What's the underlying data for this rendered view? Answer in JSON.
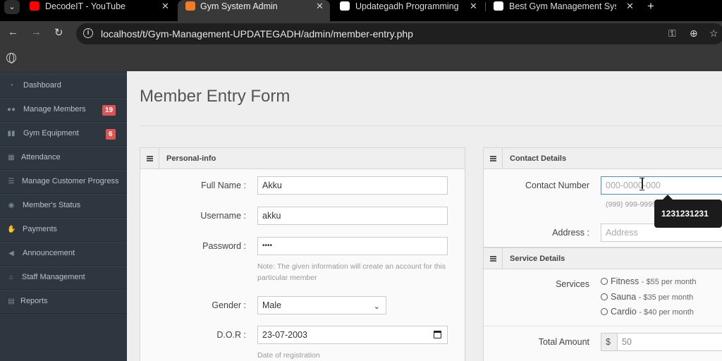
{
  "browser": {
    "tabs": [
      {
        "title": "DecodeIT - YouTube",
        "icon": "youtube-icon",
        "active": false
      },
      {
        "title": "Gym System Admin",
        "icon": "xampp-icon",
        "active": true
      },
      {
        "title": "Updategadh Programming - Up",
        "icon": "updategadh-icon",
        "active": false
      },
      {
        "title": "Best Gym Management System",
        "icon": "updategadh-icon",
        "active": false
      }
    ],
    "url": "localhost/t/Gym-Management-UPDATEGADH/admin/member-entry.php"
  },
  "sidebar": {
    "items": [
      {
        "label": "Dashboard",
        "icon": "dashboard-icon",
        "badge": null
      },
      {
        "label": "Manage Members",
        "icon": "users-icon",
        "badge": "19"
      },
      {
        "label": "Gym Equipment",
        "icon": "dumbbell-icon",
        "badge": "6"
      },
      {
        "label": "Attendance",
        "icon": "calendar-icon",
        "badge": null
      },
      {
        "label": "Manage Customer Progress",
        "icon": "list-icon",
        "badge": null
      },
      {
        "label": "Member's Status",
        "icon": "eye-icon",
        "badge": null
      },
      {
        "label": "Payments",
        "icon": "payment-icon",
        "badge": null
      },
      {
        "label": "Announcement",
        "icon": "megaphone-icon",
        "badge": null
      },
      {
        "label": "Staff Management",
        "icon": "staff-icon",
        "badge": null
      },
      {
        "label": "Reports",
        "icon": "file-icon",
        "badge": null
      }
    ]
  },
  "main": {
    "title": "Member Entry Form",
    "personal": {
      "heading": "Personal-info",
      "fullname_label": "Full Name :",
      "fullname_value": "Akku",
      "username_label": "Username :",
      "username_value": "akku",
      "password_label": "Password :",
      "password_value": "••••",
      "note": "Note: The given information will create an account for this particular member",
      "gender_label": "Gender :",
      "gender_value": "Male",
      "dor_label": "D.O.R :",
      "dor_value": "23-07-2003",
      "dor_note": "Date of registration"
    },
    "contact": {
      "heading": "Contact Details",
      "number_label": "Contact Number",
      "number_placeholder": "000-0000-000",
      "number_hint": "(999) 999-9999",
      "tooltip": "1231231231",
      "address_label": "Address :",
      "address_placeholder": "Address"
    },
    "service": {
      "heading": "Service Details",
      "services_label": "Services",
      "options": [
        {
          "name": "Fitness",
          "price": "- $55 per month"
        },
        {
          "name": "Sauna",
          "price": "- $35 per month"
        },
        {
          "name": "Cardio",
          "price": "- $40 per month"
        }
      ],
      "total_label": "Total Amount",
      "currency": "$",
      "total_value": "50"
    }
  },
  "colors": {
    "sidebar_bg": "#2e363f",
    "badge_red": "#e05353",
    "browser_dark": "#383838"
  }
}
